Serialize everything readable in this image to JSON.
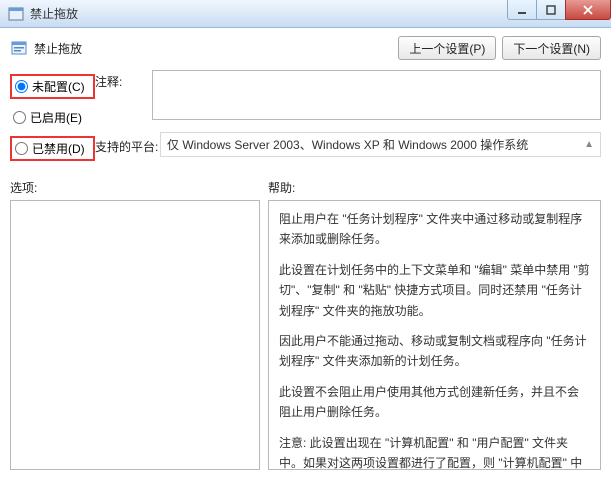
{
  "window": {
    "title": "禁止拖放"
  },
  "header": {
    "title": "禁止拖放",
    "prev_button": "上一个设置(P)",
    "next_button": "下一个设置(N)"
  },
  "radios": {
    "not_configured": "未配置(C)",
    "enabled": "已启用(E)",
    "disabled": "已禁用(D)"
  },
  "labels": {
    "comment": "注释:",
    "platform": "支持的平台:",
    "options": "选项:",
    "help": "帮助:"
  },
  "platform_text": "仅 Windows Server 2003、Windows XP 和 Windows 2000 操作系统",
  "help_paragraphs": [
    "阻止用户在 \"任务计划程序\" 文件夹中通过移动或复制程序来添加或删除任务。",
    "此设置在计划任务中的上下文菜单和 \"编辑\" 菜单中禁用 \"剪切\"、\"复制\" 和 \"粘贴\" 快捷方式项目。同时还禁用 \"任务计划程序\" 文件夹的拖放功能。",
    "因此用户不能通过拖动、移动或复制文档或程序向 \"任务计划程序\" 文件夹添加新的计划任务。",
    "此设置不会阻止用户使用其他方式创建新任务，并且不会阻止用户删除任务。",
    "注意: 此设置出现在 \"计算机配置\" 和 \"用户配置\" 文件夹中。如果对这两项设置都进行了配置，则 \"计算机配置\" 中的设置优先于 \"用户配置\" 中的设置。"
  ]
}
